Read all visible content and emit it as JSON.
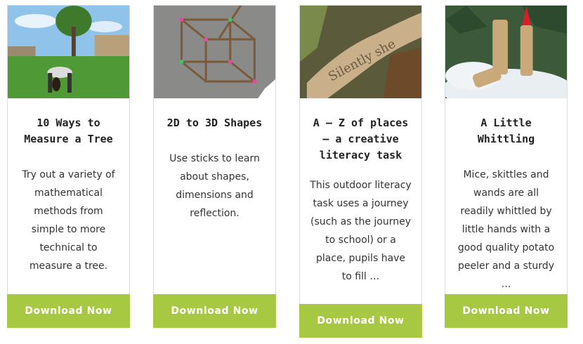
{
  "cards": [
    {
      "title": "10 Ways to Measure a Tree",
      "description": "Try out a variety of mathematical methods from simple to more technical to measure a tree.",
      "button": "Download Now",
      "image_icon": "tree-measure-photo"
    },
    {
      "title": "2D to 3D Shapes",
      "description": "Use sticks to learn about shapes, dimensions and reflection.",
      "button": "Download Now",
      "image_icon": "stick-cube-photo"
    },
    {
      "title": "A – Z of places – a creative literacy task",
      "description": "This outdoor literacy task uses a journey (such as the journey to school) or a place, pupils have to fill …",
      "button": "Download Now",
      "image_icon": "carved-wood-photo",
      "image_text": "Silently she"
    },
    {
      "title": "A Little Whittling",
      "description": "Mice, skittles and wands are all readily whittled by little hands with a good quality potato peeler and a sturdy …",
      "button": "Download Now",
      "image_icon": "whittled-figures-photo"
    }
  ],
  "colors": {
    "button_bg": "#a7c843",
    "button_text": "#ffffff",
    "card_border": "#dcdcdc"
  }
}
